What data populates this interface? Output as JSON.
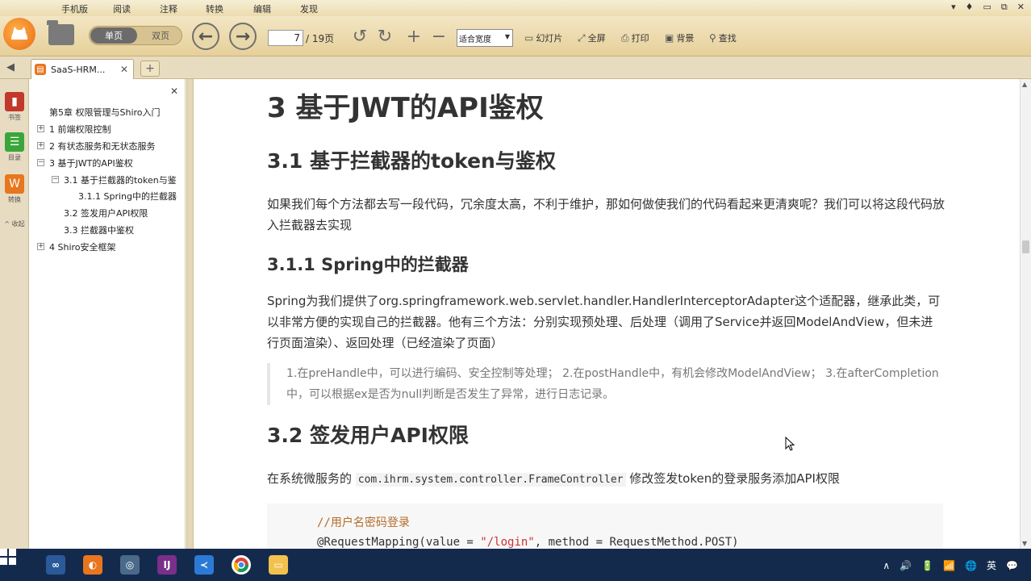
{
  "menubar": {
    "items": [
      "手机版",
      "阅读",
      "注释",
      "转换",
      "编辑",
      "发现"
    ],
    "window_controls": [
      "▾",
      "♦",
      "▭",
      "⧉",
      "✕"
    ]
  },
  "toolbar": {
    "logo_icon": "cat-logo-icon",
    "single_page": "单页",
    "double_page": "双页",
    "current_page": "7",
    "total_pages": "/ 19页",
    "zoom": "适合宽度",
    "slideshow": "幻灯片",
    "fullscreen": "全屏",
    "print": "打印",
    "background": "背景",
    "find": "查找",
    "back_glyph": "←",
    "forward_glyph": "→",
    "undo_glyph": "↺",
    "redo_glyph": "↻",
    "zoom_in_glyph": "+",
    "zoom_out_glyph": "−",
    "accent": "#e8761e"
  },
  "tabbar": {
    "collapse_glyph": "◀",
    "tab_label": "SaaS-HRM...",
    "tab_close": "✕",
    "new_tab": "+"
  },
  "rail": {
    "bookmarks": "书签",
    "contents": "目录",
    "convert": "转换",
    "collapse": "^ 收起"
  },
  "outline": {
    "close": "✕",
    "items": [
      {
        "label": "第5章 权限管理与Shiro入门",
        "exp": ""
      },
      {
        "label": "1 前端权限控制",
        "exp": "+"
      },
      {
        "label": "2 有状态服务和无状态服务",
        "exp": "+"
      },
      {
        "label": "3 基于JWT的API鉴权",
        "exp": "−"
      },
      {
        "label": "3.1 基于拦截器的token与鉴",
        "exp": "−"
      },
      {
        "label": "3.1.1 Spring中的拦截器",
        "exp": ""
      },
      {
        "label": "3.2 签发用户API权限",
        "exp": ""
      },
      {
        "label": "3.3 拦截器中鉴权",
        "exp": ""
      },
      {
        "label": "4 Shiro安全框架",
        "exp": "+"
      }
    ]
  },
  "doc": {
    "h1": "3 基于JWT的API鉴权",
    "h2_1": "3.1 基于拦截器的token与鉴权",
    "p1": "如果我们每个方法都去写一段代码，冗余度太高，不利于维护，那如何做使我们的代码看起来更清爽呢？我们可以将这段代码放入拦截器去实现",
    "h3_1": "3.1.1 Spring中的拦截器",
    "p2": "Spring为我们提供了org.springframework.web.servlet.handler.HandlerInterceptorAdapter这个适配器，继承此类，可以非常方便的实现自己的拦截器。他有三个方法：分别实现预处理、后处理（调用了Service并返回ModelAndView，但未进行页面渲染）、返回处理（已经渲染了页面）",
    "quote": "1.在preHandle中，可以进行编码、安全控制等处理； 2.在postHandle中，有机会修改ModelAndView； 3.在afterCompletion中，可以根据ex是否为null判断是否发生了异常，进行日志记录。",
    "h2_2": "3.2 签发用户API权限",
    "p3_before": "在系统微服务的 ",
    "p3_code": "com.ihrm.system.controller.FrameController",
    "p3_after": " 修改签发token的登录服务添加API权限",
    "code_comment": "//用户名密码登录",
    "code_line_a": "@RequestMapping(value = ",
    "code_line_str": "\"/login\"",
    "code_line_b": ", method = RequestMethod.POST)"
  },
  "taskbar": {
    "tray_lang": "英",
    "tray_icons": [
      "∧",
      "🔊",
      "🔋",
      "📶",
      "🌐",
      "💬"
    ]
  }
}
